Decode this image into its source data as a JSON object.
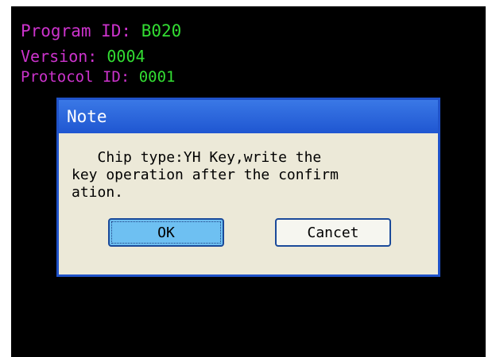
{
  "info": {
    "program_label": "Program ID: ",
    "program_value": "B020",
    "version_label": "Version: ",
    "version_value": "0004",
    "protocol_label": "Protocol ID: ",
    "protocol_value": "0001"
  },
  "dialog": {
    "title": "Note",
    "message": "   Chip type:YH Key,write the\nkey operation after the confirm\nation.",
    "ok_label": "OK",
    "cancel_label": "Cancet"
  },
  "colors": {
    "label_magenta": "#cc33cc",
    "value_green": "#33dd33",
    "title_bar_blue": "#1f56d1",
    "dialog_face": "#ece9d8",
    "ok_button": "#6ec0f2"
  }
}
